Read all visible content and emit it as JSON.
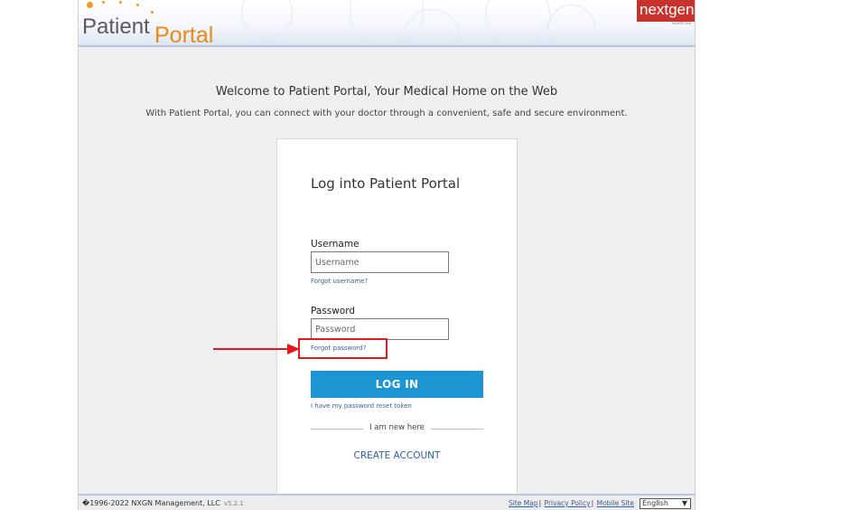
{
  "header": {
    "logo_patient": "Patient",
    "logo_portal": "Portal",
    "brand": "nextgen",
    "brand_sub": "healthcare"
  },
  "welcome": {
    "title": "Welcome to Patient Portal, Your Medical Home on the Web",
    "subtitle": "With Patient Portal, you can connect with your doctor through a convenient, safe and secure environment."
  },
  "login": {
    "title": "Log into Patient Portal",
    "username_label": "Username",
    "username_placeholder": "Username",
    "forgot_username": "Forgot username?",
    "password_label": "Password",
    "password_placeholder": "Password",
    "forgot_password": "Forgot password?",
    "login_button": "LOG IN",
    "reset_token_link": "I have my password reset token",
    "new_here": "I am new here",
    "create_account": "CREATE ACCOUNT"
  },
  "footer": {
    "copyright": "�1996-2022 NXGN Management, LLC",
    "version": "v5.2.1",
    "links": [
      "Site Map",
      "Privacy Policy",
      "Mobile Site"
    ],
    "language": "English"
  },
  "colors": {
    "accent_blue": "#1d95d2",
    "portal_orange": "#e88a16",
    "annotation_red": "#e3191c",
    "brand_red": "#c7322c"
  },
  "icons": {
    "annotation": "right-arrow-icon",
    "language_select": "chevron-down-icon"
  }
}
